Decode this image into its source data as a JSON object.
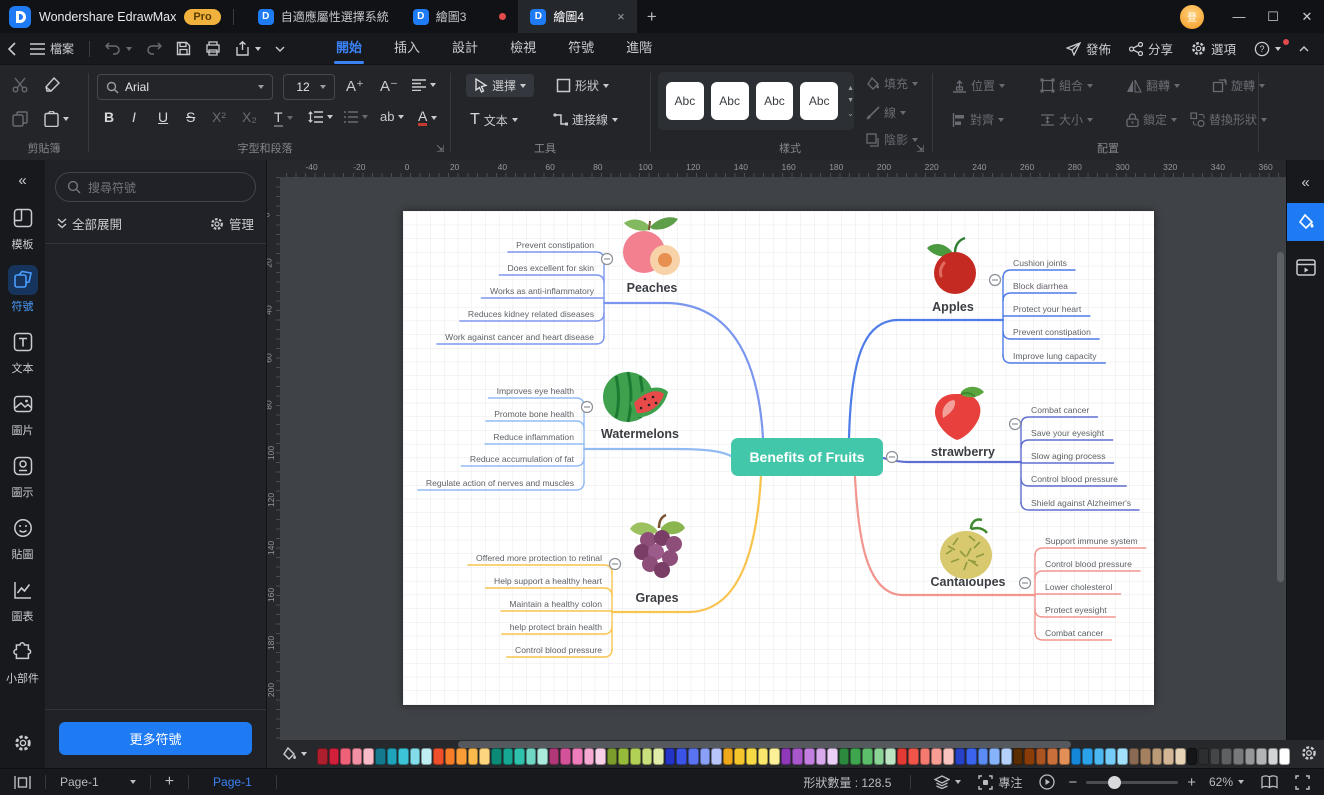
{
  "window": {
    "app_title": "Wondershare EdrawMax",
    "pro_badge": "Pro",
    "tabs": [
      {
        "label": "自適應屬性選擇系統"
      },
      {
        "label": "繪圖3"
      },
      {
        "label": "繪圖4"
      }
    ],
    "user_badge": "登"
  },
  "menubar": {
    "file_label": "檔案",
    "tabs": [
      {
        "label": "開始"
      },
      {
        "label": "插入"
      },
      {
        "label": "設計"
      },
      {
        "label": "檢視"
      },
      {
        "label": "符號"
      },
      {
        "label": "進階"
      }
    ],
    "publish": "發佈",
    "share": "分享",
    "options": "選項"
  },
  "ribbon": {
    "clipboard_label": "剪貼簿",
    "font_family": "Arial",
    "font_size": "12",
    "font_section_label": "字型和段落",
    "fmt": {
      "bold": "B",
      "italic": "I",
      "underline": "U",
      "strike": "S",
      "sup": "X²",
      "sub": "X₂",
      "ab": "ab",
      "color": "A"
    },
    "tools_label": "工具",
    "select": "選擇",
    "shape": "形狀",
    "text": "文本",
    "connector": "連接線",
    "style_label": "樣式",
    "style_preview": "Abc",
    "fill": "填充",
    "line": "線",
    "shadow": "陰影",
    "arrange_label": "配置",
    "position": "位置",
    "group": "組合",
    "flip": "翻轉",
    "rotate": "旋轉",
    "align": "對齊",
    "size": "大小",
    "lock": "鎖定",
    "replace": "替換形狀"
  },
  "sidebar": {
    "items": [
      {
        "label": "模板"
      },
      {
        "label": "符號"
      },
      {
        "label": "文本"
      },
      {
        "label": "圖片"
      },
      {
        "label": "圖示"
      },
      {
        "label": "貼圖"
      },
      {
        "label": "圖表"
      },
      {
        "label": "小部件"
      }
    ]
  },
  "panel": {
    "search_placeholder": "搜尋符號",
    "expand_all": "全部展開",
    "manage": "管理",
    "more_symbols": "更多符號"
  },
  "canvas": {
    "ruler_h": [
      "-40",
      "-20",
      "0",
      "20",
      "40",
      "60",
      "80",
      "100",
      "120",
      "140",
      "160",
      "180",
      "200",
      "220",
      "240",
      "260",
      "280",
      "300",
      "320",
      "340",
      "360"
    ],
    "ruler_v": [
      "0",
      "20",
      "40",
      "60",
      "80",
      "100",
      "120",
      "140",
      "160",
      "180",
      "200"
    ]
  },
  "mindmap": {
    "center": {
      "label": "Benefits of Fruits",
      "color": "#43c7ab"
    },
    "topics": [
      {
        "name": "Peaches",
        "color": "#7b96ee",
        "side": "left",
        "leaves": [
          "Prevent constipation",
          "Does excellent for skin",
          "Works as anti-inflammatory",
          "Reduces kidney related diseases",
          "Work against cancer and heart disease"
        ]
      },
      {
        "name": "Watermelons",
        "color": "#92bbf4",
        "side": "left",
        "leaves": [
          "Improves eye health",
          "Promote bone health",
          "Reduce inflammation",
          "Reduce accumulation of fat",
          "Regulate action of nerves and muscles"
        ]
      },
      {
        "name": "Grapes",
        "color": "#f8c44e",
        "side": "left",
        "leaves": [
          "Offered more protection to retinal",
          "Help support a healthy heart",
          "Maintain a healthy colon",
          "help protect brain health",
          "Control blood pressure"
        ]
      },
      {
        "name": "Apples",
        "color": "#4e7ce8",
        "side": "right",
        "leaves": [
          "Cushion joints",
          "Block diarrhea",
          "Protect your heart",
          "Prevent constipation",
          "Improve lung capacity"
        ]
      },
      {
        "name": "strawberry",
        "color": "#5f6ed0",
        "side": "right",
        "leaves": [
          "Combat cancer",
          "Save your eyesight",
          "Slow aging process",
          "Control blood pressure",
          "Shield against Alzheimer's"
        ]
      },
      {
        "name": "Cantaloupes",
        "color": "#f2958e",
        "side": "right",
        "leaves": [
          "Support immune system",
          "Control blood pressure",
          "Lower cholesterol",
          "Protect eyesight",
          "Combat cancer"
        ]
      }
    ]
  },
  "palette": {
    "colors": [
      "#ad1f2d",
      "#d21f3c",
      "#ef6079",
      "#f391a4",
      "#f7bcc8",
      "#15798e",
      "#1fa3bb",
      "#3cc3d8",
      "#82dcea",
      "#c0eef5",
      "#f04f2c",
      "#f77c28",
      "#fa9d36",
      "#fcba4c",
      "#fdd57f",
      "#0c8a75",
      "#16a893",
      "#2ec2ac",
      "#70d7c5",
      "#abe9dc",
      "#b03878",
      "#d4529a",
      "#ef7cbb",
      "#f5a9d3",
      "#f9d0e7",
      "#7c9c2c",
      "#96ba3a",
      "#b0d155",
      "#c9e17d",
      "#e0eda9",
      "#2334c6",
      "#3b53e6",
      "#5a73f1",
      "#8aa0f6",
      "#b8c5fa",
      "#efa71c",
      "#f4c52c",
      "#f7db46",
      "#fae86c",
      "#fcf198",
      "#9038ba",
      "#a957cd",
      "#c37fe0",
      "#d9a9ed",
      "#eccff7",
      "#2b8a3e",
      "#3da64f",
      "#5cbe6b",
      "#8ad495",
      "#bce6c3",
      "#e33a34",
      "#f05549",
      "#f4796e",
      "#f79d94",
      "#fac4be",
      "#2742c8",
      "#3a63ee",
      "#5b8cf5",
      "#86b3f9",
      "#b4d2fb",
      "#5a2d00",
      "#8a3d08",
      "#aa5422",
      "#c96f3a",
      "#e29058",
      "#1487d8",
      "#2ba2ea",
      "#4cb8f2",
      "#74ccf7",
      "#a2e0fb",
      "#8a6a52",
      "#a3805f",
      "#bb9a77",
      "#d2b695",
      "#e6d2b4",
      "#141618",
      "#2c2e30",
      "#444648",
      "#5e6062",
      "#78797b",
      "#949698",
      "#b2b4b6",
      "#d2d4d6",
      "#ffffff"
    ]
  },
  "statusbar": {
    "page_dropdown": "Page-1",
    "add_page": "+",
    "page_tab": "Page-1",
    "shape_count": "形狀數量 : 128.5",
    "focus_label": "專注",
    "zoom_value": "62%"
  }
}
